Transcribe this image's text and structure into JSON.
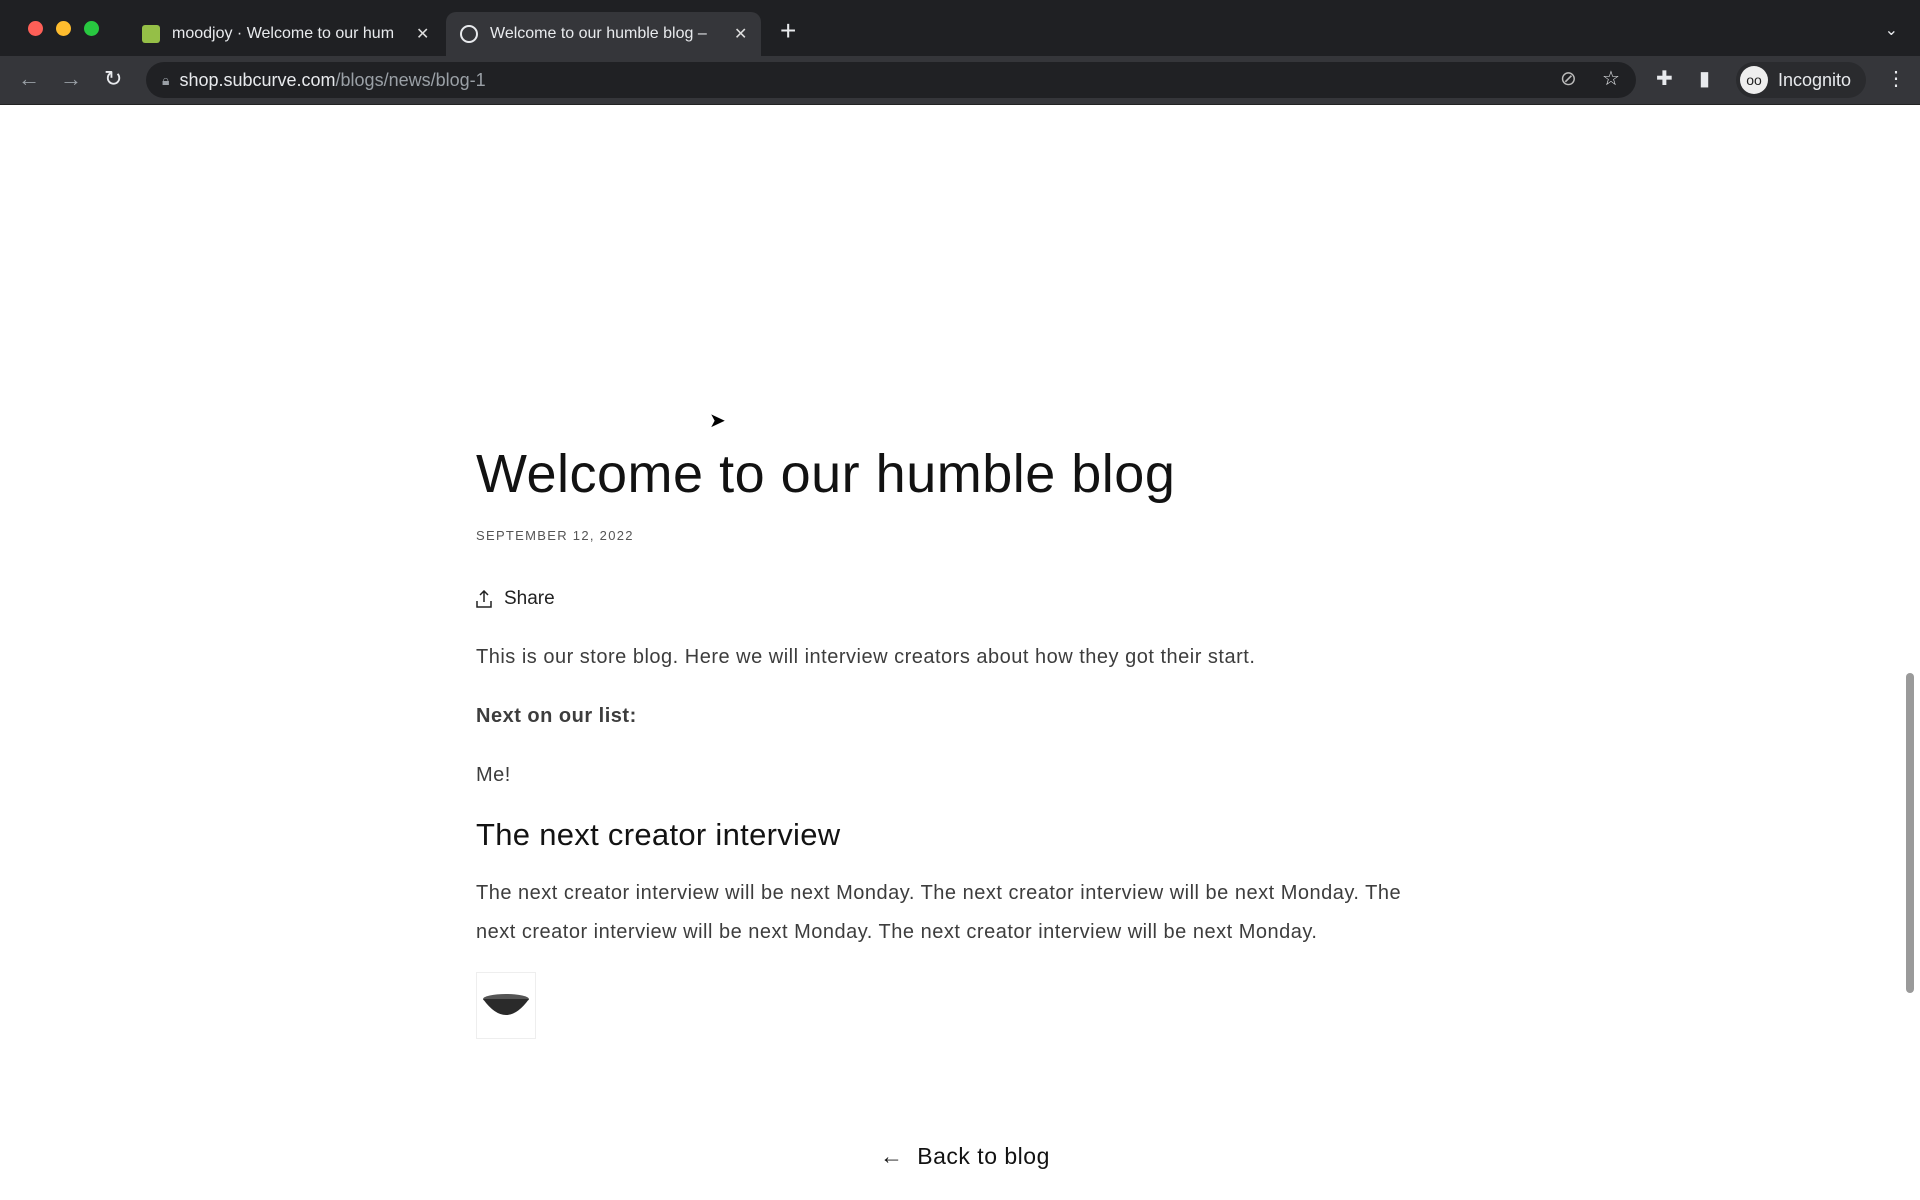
{
  "browser": {
    "tabs": [
      {
        "title": "moodjoy · Welcome to our hum",
        "icon": "shopify-icon"
      },
      {
        "title": "Welcome to our humble blog –",
        "icon": "globe-icon",
        "active": true
      }
    ],
    "url_host": "shop.subcurve.com",
    "url_path": "/blogs/news/blog-1",
    "profile": "Incognito"
  },
  "article": {
    "title": "Welcome to our humble blog",
    "date": "SEPTEMBER 12, 2022",
    "share": "Share",
    "intro": "This is our store blog. Here we will interview creators about how they got their start.",
    "next_label": "Next on our list:",
    "next_value": "Me!",
    "subheading": "The next creator interview",
    "paragraph": "The next creator interview will be next Monday.  The next creator interview will be next Monday. The next creator interview will be next Monday. The next creator interview will be next Monday.",
    "back": "Back to blog"
  }
}
